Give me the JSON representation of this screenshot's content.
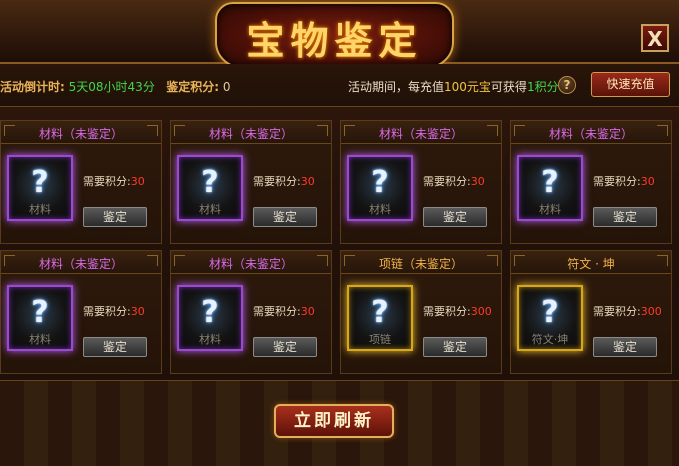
{
  "window": {
    "title": "宝物鉴定",
    "close_label": "X"
  },
  "infobar": {
    "countdown_label": "活动倒计时:",
    "countdown_value": "5天08小时43分",
    "points_label": "鉴定积分:",
    "points_value": "0",
    "promo_prefix": "活动期间，每充值",
    "promo_amount": "100元宝",
    "promo_middle": "可获得",
    "promo_points": "1积分",
    "promo_suffix": "!",
    "help_icon": "?",
    "recharge_button": "快速充值"
  },
  "cards": [
    {
      "title": "材料（未鉴定）",
      "rarity": "purple",
      "item_label": "材料",
      "cost_label": "需要积分:",
      "cost": "30",
      "button": "鉴定"
    },
    {
      "title": "材料（未鉴定）",
      "rarity": "purple",
      "item_label": "材料",
      "cost_label": "需要积分:",
      "cost": "30",
      "button": "鉴定"
    },
    {
      "title": "材料（未鉴定）",
      "rarity": "purple",
      "item_label": "材料",
      "cost_label": "需要积分:",
      "cost": "30",
      "button": "鉴定"
    },
    {
      "title": "材料（未鉴定）",
      "rarity": "purple",
      "item_label": "材料",
      "cost_label": "需要积分:",
      "cost": "30",
      "button": "鉴定"
    },
    {
      "title": "材料（未鉴定）",
      "rarity": "purple",
      "item_label": "材料",
      "cost_label": "需要积分:",
      "cost": "30",
      "button": "鉴定"
    },
    {
      "title": "材料（未鉴定）",
      "rarity": "purple",
      "item_label": "材料",
      "cost_label": "需要积分:",
      "cost": "30",
      "button": "鉴定"
    },
    {
      "title": "项链（未鉴定）",
      "rarity": "gold",
      "item_label": "项链",
      "cost_label": "需要积分:",
      "cost": "300",
      "button": "鉴定"
    },
    {
      "title": "符文 · 坤",
      "rarity": "gold",
      "item_label": "符文·坤",
      "cost_label": "需要积分:",
      "cost": "300",
      "button": "鉴定"
    }
  ],
  "footer": {
    "refresh_button": "立即刷新"
  },
  "colors": {
    "purple_border": "#9a4ad0",
    "gold_border": "#d7a81a",
    "cost_red": "#ff3a2a",
    "countdown_green": "#41d64b"
  }
}
